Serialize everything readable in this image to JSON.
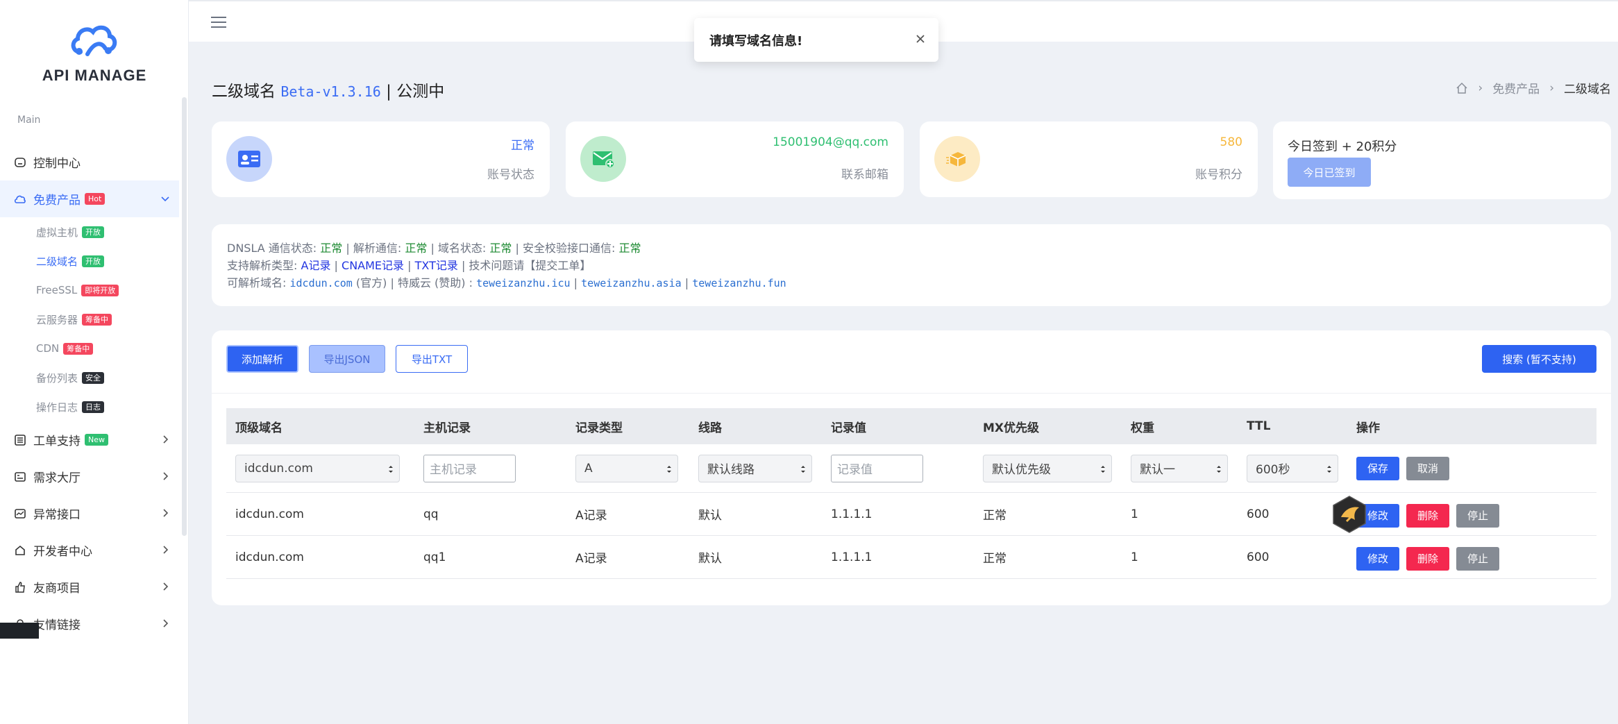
{
  "sidebar": {
    "logo_text": "API MANAGE",
    "section_label": "Main",
    "items": [
      {
        "label": "控制中心",
        "icon": "home-icon"
      },
      {
        "label": "免费产品",
        "icon": "cloud-icon",
        "badge": "Hot"
      },
      {
        "label": "工单支持",
        "icon": "ticket-icon",
        "badge": "New"
      },
      {
        "label": "需求大厅",
        "icon": "list-icon"
      },
      {
        "label": "异常接口",
        "icon": "chart-icon"
      },
      {
        "label": "开发者中心",
        "icon": "developer-icon"
      },
      {
        "label": "友商项目",
        "icon": "thumb-icon"
      },
      {
        "label": "友情链接",
        "icon": "link-icon"
      }
    ],
    "sub_items": [
      {
        "label": "虚拟主机",
        "badge": "开放"
      },
      {
        "label": "二级域名",
        "badge": "开放"
      },
      {
        "label": "FreeSSL",
        "badge": "即将开放"
      },
      {
        "label": "云服务器",
        "badge": "筹备中"
      },
      {
        "label": "CDN",
        "badge": "筹备中"
      },
      {
        "label": "备份列表",
        "badge": "安全"
      },
      {
        "label": "操作日志",
        "badge": "日志"
      }
    ]
  },
  "toast": {
    "message": "请填写域名信息!"
  },
  "header": {
    "title": "二级域名",
    "version": "Beta-v1.3.16",
    "separator": "|",
    "status": "公测中"
  },
  "breadcrumb": {
    "parent": "免费产品",
    "current": "二级域名"
  },
  "stats": [
    {
      "value": "正常",
      "label": "账号状态",
      "color": "#3a6cf4"
    },
    {
      "value": "15001904@qq.com",
      "label": "联系邮箱",
      "color": "#2fbf71"
    },
    {
      "value": "580",
      "label": "账号积分",
      "color": "#f6b73c"
    }
  ],
  "sign": {
    "title": "今日签到 + 20积分",
    "button": "今日已签到"
  },
  "info": {
    "line1_label1": "DNSLA 通信状态:",
    "line1_value1": "正常",
    "line1_label2": "| 解析通信:",
    "line1_value2": "正常",
    "line1_label3": "| 域名状态:",
    "line1_value3": "正常",
    "line1_label4": "| 安全校验接口通信:",
    "line1_value4": "正常",
    "line2_label": "支持解析类型:",
    "line2_type1": "A记录",
    "line2_sep1": "|",
    "line2_type2": "CNAME记录",
    "line2_sep2": "|",
    "line2_type3": "TXT记录",
    "line2_tail": "| 技术问题请【提交工单】",
    "line3_label": "可解析域名:",
    "line3_d1": "idcdun.com",
    "line3_mid": "(官方) | 特威云 (赞助) :",
    "line3_d2": "teweizanzhu.icu",
    "line3_sep1": "|",
    "line3_d3": "teweizanzhu.asia",
    "line3_sep2": "|",
    "line3_d4": "teweizanzhu.fun"
  },
  "toolbar": {
    "add": "添加解析",
    "export_json": "导出JSON",
    "export_txt": "导出TXT",
    "search": "搜索 (暂不支持)"
  },
  "table": {
    "headers": [
      "顶级域名",
      "主机记录",
      "记录类型",
      "线路",
      "记录值",
      "MX优先级",
      "权重",
      "TTL",
      "操作"
    ],
    "form": {
      "domain": "idcdun.com",
      "host_placeholder": "主机记录",
      "type": "A",
      "line": "默认线路",
      "value_placeholder": "记录值",
      "mx": "默认优先级",
      "weight": "默认一",
      "ttl": "600秒",
      "save": "保存",
      "cancel": "取消"
    },
    "rows": [
      {
        "domain": "idcdun.com",
        "host": "qq",
        "type": "A记录",
        "line": "默认",
        "value": "1.1.1.1",
        "mx": "正常",
        "weight": "1",
        "ttl": "600"
      },
      {
        "domain": "idcdun.com",
        "host": "qq1",
        "type": "A记录",
        "line": "默认",
        "value": "1.1.1.1",
        "mx": "正常",
        "weight": "1",
        "ttl": "600"
      }
    ],
    "actions": {
      "edit": "修改",
      "delete": "删除",
      "stop": "停止"
    }
  }
}
